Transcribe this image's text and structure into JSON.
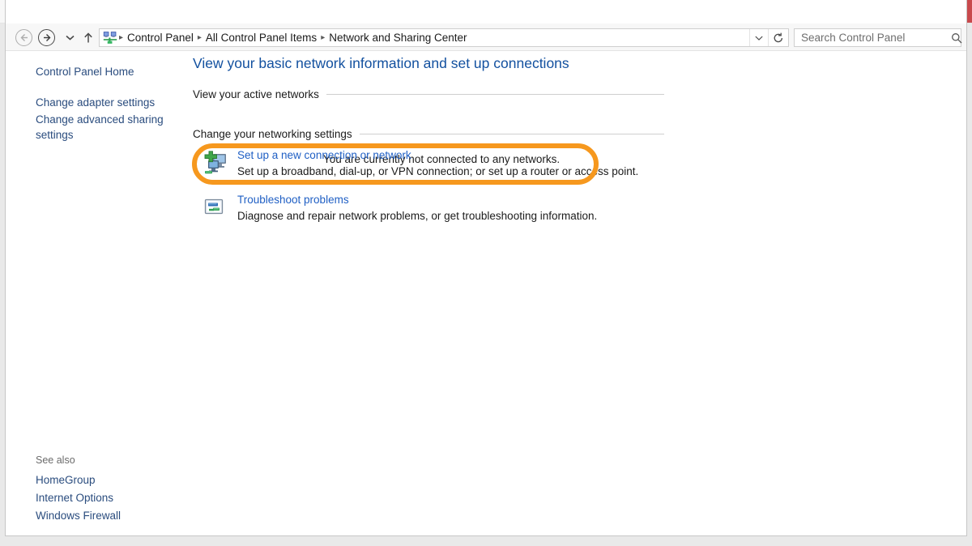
{
  "window": {
    "title": "Network and Sharing Center",
    "title_icon": "network-sharing-icon",
    "minimize_label": "–",
    "maximize_label": "□",
    "close_label": "✕",
    "close_color": "#c8494c"
  },
  "navbar": {
    "back_icon": "back-arrow-icon",
    "forward_icon": "forward-arrow-icon",
    "recent_icon": "chevron-down-icon",
    "up_icon": "up-arrow-icon",
    "address_icon": "control-panel-icon",
    "breadcrumbs": [
      "Control Panel",
      "All Control Panel Items",
      "Network and Sharing Center"
    ],
    "separator": "▸",
    "dropdown_icon": "chevron-down-icon",
    "refresh_icon": "refresh-icon"
  },
  "search": {
    "placeholder": "Search Control Panel",
    "value": "",
    "icon": "search-icon"
  },
  "sidebar": {
    "home_label": "Control Panel Home",
    "items": [
      {
        "label": "Change adapter settings"
      },
      {
        "label": "Change advanced sharing settings"
      }
    ],
    "see_also_label": "See also",
    "see_also": [
      {
        "label": "HomeGroup"
      },
      {
        "label": "Internet Options"
      },
      {
        "label": "Windows Firewall"
      }
    ]
  },
  "main": {
    "page_title": "View your basic network information and set up connections",
    "sections": {
      "active_networks_label": "View your active networks",
      "status_text": "You are currently not connected to any networks.",
      "networking_settings_label": "Change your networking settings"
    },
    "tasks": [
      {
        "icon": "new-connection-icon",
        "link": "Set up a new connection or network",
        "description": "Set up a broadband, dial-up, or VPN connection; or set up a router or access point.",
        "highlighted": true
      },
      {
        "icon": "troubleshoot-icon",
        "link": "Troubleshoot problems",
        "description": "Diagnose and repair network problems, or get troubleshooting information.",
        "highlighted": false
      }
    ]
  },
  "annotation": {
    "highlight_color": "#f6981e",
    "target": "Set up a new connection or network"
  }
}
